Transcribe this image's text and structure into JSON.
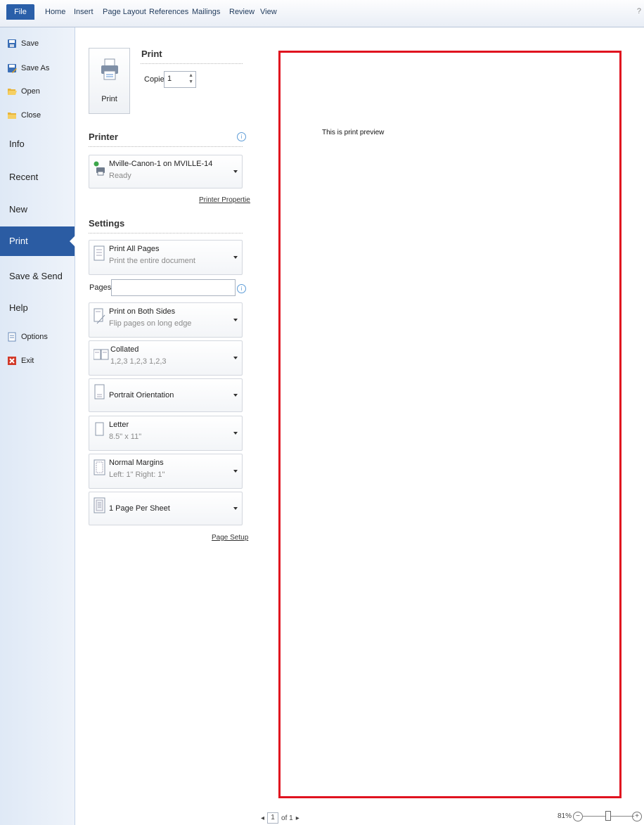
{
  "ribbon": {
    "file_tab": "File",
    "tabs": [
      "Home",
      "Insert",
      "Page Layout",
      "References",
      "Mailings",
      "Review",
      "View"
    ],
    "help": "?"
  },
  "nav": {
    "save": "Save",
    "save_as": "Save As",
    "open": "Open",
    "close": "Close",
    "info": "Info",
    "recent": "Recent",
    "new": "New",
    "print": "Print",
    "save_send": "Save & Send",
    "help": "Help",
    "options": "Options",
    "exit": "Exit"
  },
  "print_panel": {
    "print_button_label": "Print",
    "heading": "Print",
    "copies_label": "Copies:",
    "copies_value": "1",
    "printer_heading": "Printer",
    "printer_name": "Mville-Canon-1 on MVILLE-14",
    "printer_status": "Ready",
    "printer_properties": "Printer Properties",
    "settings_heading": "Settings",
    "print_what": "Print All Pages",
    "print_what_desc": "Print the entire document",
    "pages_label": "Pages:",
    "pages_value": "",
    "duplex": "Print on Both Sides",
    "duplex_desc": "Flip pages on long edge",
    "collate": "Collated",
    "collate_desc": "1,2,3   1,2,3   1,2,3",
    "orientation": "Portrait Orientation",
    "paper": "Letter",
    "paper_desc": "8.5\" x 11\"",
    "margins": "Normal Margins",
    "margins_desc": "Left: 1\"   Right: 1\"",
    "per_sheet": "1 Page Per Sheet",
    "page_setup": "Page Setup"
  },
  "preview": {
    "page_text": "This is print preview",
    "page_border_color": "#e0131f",
    "current_page": "1",
    "of_pages": "of 1",
    "zoom": "81%"
  }
}
